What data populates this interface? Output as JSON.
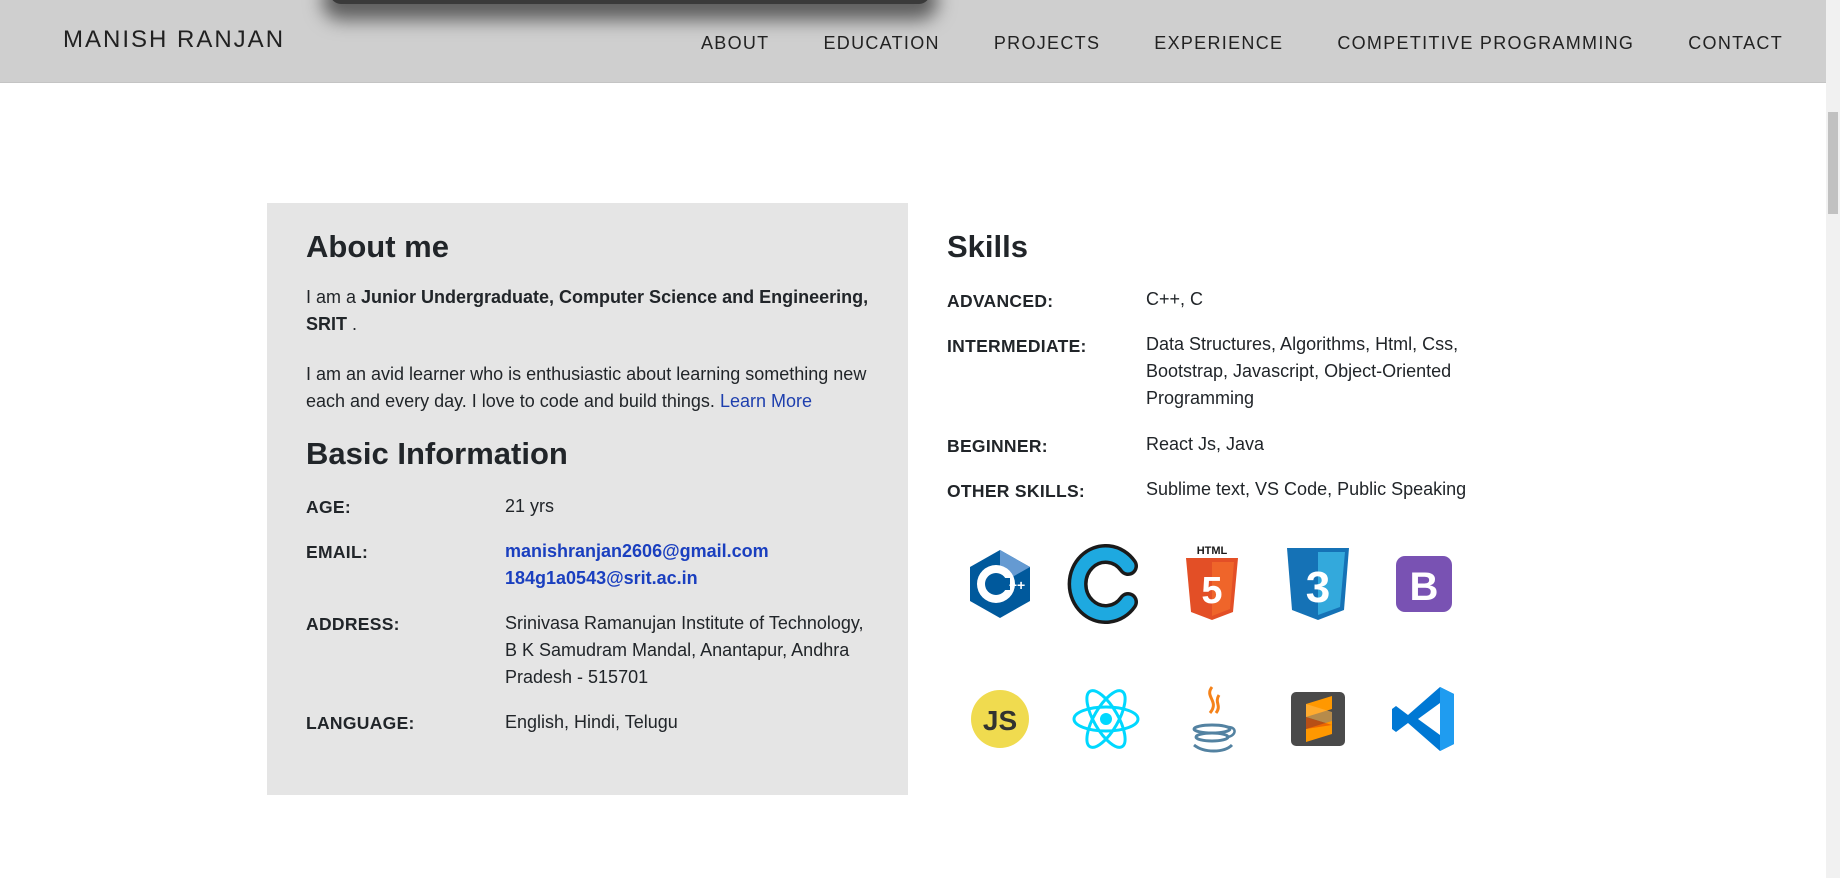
{
  "nav": {
    "brand": "MANISH RANJAN",
    "links": [
      "ABOUT",
      "EDUCATION",
      "PROJECTS",
      "EXPERIENCE",
      "COMPETITIVE PROGRAMMING",
      "CONTACT"
    ]
  },
  "about": {
    "title": "About me",
    "intro_prefix": "I am a ",
    "intro_bold": "Junior Undergraduate, Computer Science and Engineering, SRIT",
    "intro_suffix": " .",
    "bio": "I am an avid learner who is enthusiastic about learning something new each and every day. I love to code and build things. ",
    "learn_more": "Learn More"
  },
  "basic": {
    "title": "Basic Information",
    "age_label": "AGE:",
    "age": "21 yrs",
    "email_label": "EMAIL:",
    "email_1": "manishranjan2606@gmail.com",
    "email_2": "184g1a0543@srit.ac.in",
    "address_label": "ADDRESS:",
    "address": "Srinivasa Ramanujan Institute of Technology, B K Samudram Mandal, Anantapur, Andhra Pradesh - 515701",
    "language_label": "LANGUAGE:",
    "language": "English, Hindi, Telugu"
  },
  "skills": {
    "title": "Skills",
    "advanced_label": "ADVANCED:",
    "advanced": "C++, C",
    "intermediate_label": "INTERMEDIATE:",
    "intermediate": "Data Structures, Algorithms, Html, Css, Bootstrap, Javascript, Object-Oriented Programming",
    "beginner_label": "BEGINNER:",
    "beginner": "React Js, Java",
    "other_label": "OTHER SKILLS:",
    "other": "Sublime text, VS Code, Public Speaking",
    "logos": {
      "cpp": "C++",
      "c": "C",
      "html_caption": "HTML",
      "html": "5",
      "css": "3",
      "bootstrap": "B",
      "js": "JS"
    }
  },
  "colors": {
    "navbar": "#cfcfcf",
    "panel": "#e5e5e5",
    "link": "#1a3fbf",
    "cpp": "#00599c",
    "c": "#1ea9e0",
    "html": "#e34f26",
    "css": "#1572b6",
    "bootstrap": "#7952b3",
    "js": "#f0db4f",
    "react": "#61dafb",
    "java_cup": "#5382a1",
    "java_steam": "#f58219",
    "sublime_bg": "#4a4a4a",
    "sublime_s": "#ff9800",
    "vscode": "#0078d4"
  }
}
